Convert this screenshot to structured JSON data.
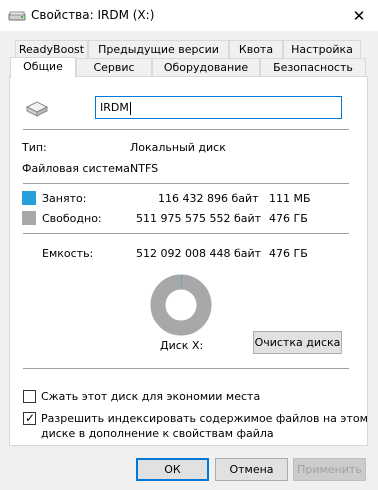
{
  "window": {
    "title": "Свойства: IRDM (X:)",
    "close_glyph": "✕"
  },
  "tabs_row1": [
    {
      "label": "ReadyBoost"
    },
    {
      "label": "Предыдущие версии"
    },
    {
      "label": "Квота"
    },
    {
      "label": "Настройка"
    }
  ],
  "tabs_row2": [
    {
      "label": "Общие",
      "active": true
    },
    {
      "label": "Сервис"
    },
    {
      "label": "Оборудование"
    },
    {
      "label": "Безопасность"
    }
  ],
  "general": {
    "volume_name": "IRDM",
    "type_label": "Тип:",
    "type_value": "Локальный диск",
    "fs_label": "Файловая система:",
    "fs_value": "NTFS",
    "used_label": "Занято:",
    "used_bytes": "116 432 896 байт",
    "used_short": "111 МБ",
    "free_label": "Свободно:",
    "free_bytes": "511 975 575 552 байт",
    "free_short": "476 ГБ",
    "capacity_label": "Емкость:",
    "capacity_bytes": "512 092 008 448 байт",
    "capacity_short": "476 ГБ",
    "disk_label": "Диск X:",
    "cleanup_button": "Очистка диска",
    "compress_label": "Сжать этот диск для экономии места",
    "compress_checked": false,
    "index_label_line1": "Разрешить индексировать содержимое файлов на этом",
    "index_label_line2": "диске в дополнение к свойствам файла",
    "index_checked": true
  },
  "colors": {
    "used": "#26a0da",
    "free": "#a8a8a8"
  },
  "usage": {
    "used_fraction": 0.000227
  },
  "buttons": {
    "ok": "ОК",
    "cancel": "Отмена",
    "apply": "Применить"
  },
  "icons": {
    "window": "drive-icon",
    "close": "close-icon",
    "volume": "drive-icon",
    "check": "checkmark-icon"
  }
}
